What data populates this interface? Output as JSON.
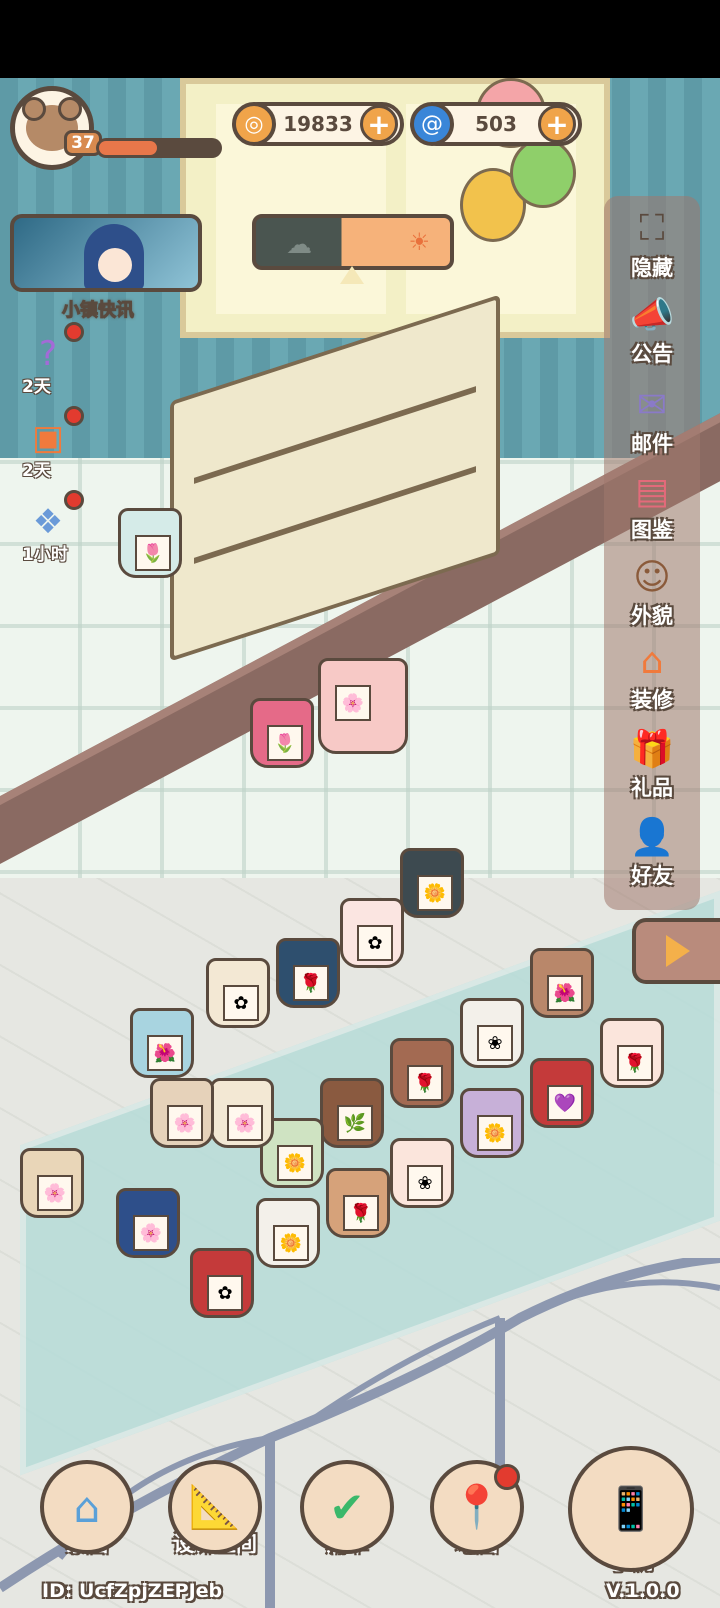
{
  "player": {
    "level": "37",
    "xp_fraction": 0.48,
    "avatar_icon": "bear-icon"
  },
  "currencies": [
    {
      "name": "coin",
      "icon": "coin-icon",
      "value": "19833",
      "color": "#f0a44a"
    },
    {
      "name": "gem",
      "icon": "swirl-icon",
      "value": "503",
      "color": "#3a86d8"
    }
  ],
  "news": {
    "label": "小镇快讯"
  },
  "events": [
    {
      "icon": "hook-icon",
      "count": "2天"
    },
    {
      "icon": "shop-icon",
      "count": "2天"
    },
    {
      "icon": "gift-stack-icon",
      "count": "1小时"
    }
  ],
  "side_menu": [
    {
      "label": "隐藏",
      "icon": "hide-frame-icon"
    },
    {
      "label": "公告",
      "icon": "megaphone-icon"
    },
    {
      "label": "邮件",
      "icon": "mail-icon"
    },
    {
      "label": "图鉴",
      "icon": "album-icon"
    },
    {
      "label": "外貌",
      "icon": "face-icon"
    },
    {
      "label": "装修",
      "icon": "house-wrench-icon"
    },
    {
      "label": "礼品",
      "icon": "gift-icon"
    },
    {
      "label": "好友",
      "icon": "contacts-icon"
    }
  ],
  "bottom_nav": [
    {
      "label": "家园",
      "icon": "home-icon"
    },
    {
      "label": "设计空间",
      "icon": "ruler-icon"
    },
    {
      "label": "清单",
      "icon": "checklist-icon"
    },
    {
      "label": "地图",
      "icon": "map-pin-icon"
    }
  ],
  "phone": {
    "label": "手机",
    "version": "V.1.0.0"
  },
  "user_id": "ID: UcfZpjZEPJeb",
  "colors": {
    "outline": "#5a4a3e",
    "accent": "#f0a44a",
    "badge": "#e23b2f"
  }
}
